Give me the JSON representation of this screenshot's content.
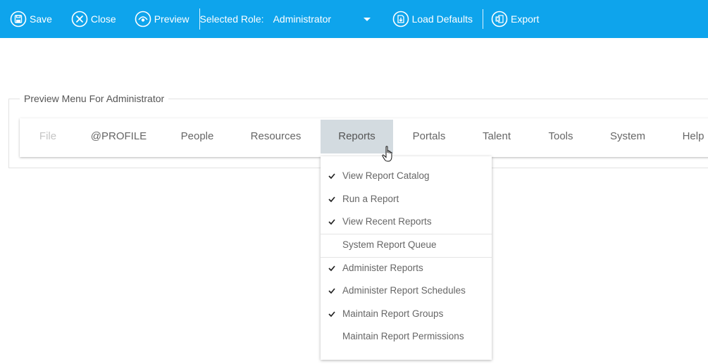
{
  "toolbar": {
    "save_label": "Save",
    "close_label": "Close",
    "preview_label": "Preview",
    "role_label": "Selected Role:",
    "role_value": "Administrator",
    "load_defaults_label": "Load Defaults",
    "export_label": "Export"
  },
  "preview": {
    "legend": "Preview Menu For Administrator"
  },
  "menu": {
    "items": [
      {
        "label": "File",
        "state": "disabled"
      },
      {
        "label": "@PROFILE"
      },
      {
        "label": "People"
      },
      {
        "label": "Resources"
      },
      {
        "label": "Reports",
        "state": "active"
      },
      {
        "label": "Portals"
      },
      {
        "label": "Talent"
      },
      {
        "label": "Tools"
      },
      {
        "label": "System"
      },
      {
        "label": "Help"
      }
    ]
  },
  "dropdown": {
    "items": [
      {
        "label": "View Report Catalog",
        "checked": true
      },
      {
        "label": "Run a Report",
        "checked": true
      },
      {
        "label": "View Recent Reports",
        "checked": true
      },
      {
        "label": "System Report Queue",
        "checked": false
      },
      {
        "label": "Administer Reports",
        "checked": true
      },
      {
        "label": "Administer Report Schedules",
        "checked": true
      },
      {
        "label": "Maintain Report Groups",
        "checked": true
      },
      {
        "label": "Maintain Report Permissions",
        "checked": false
      }
    ]
  },
  "colors": {
    "toolbar_bg": "#0ea4ec",
    "active_menu_bg": "#d3dbe0"
  },
  "icons": {
    "save": "save-icon",
    "close": "close-icon",
    "preview": "preview-icon",
    "dropdown": "chevron-down-icon",
    "load_defaults": "load-defaults-icon",
    "export": "excel-export-icon",
    "check": "check-icon",
    "cursor": "hand-cursor-icon"
  }
}
